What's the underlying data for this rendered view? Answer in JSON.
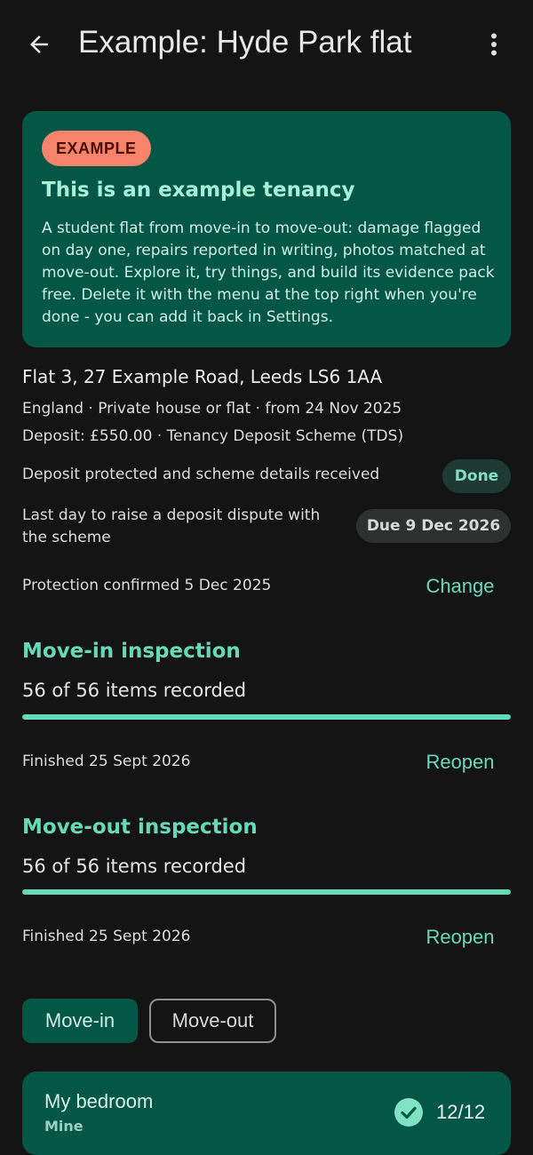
{
  "header": {
    "title": "Example: Hyde Park flat",
    "back_icon": "arrow-left-icon",
    "menu_icon": "more-vert-icon"
  },
  "example_card": {
    "badge": "EXAMPLE",
    "heading": "This is an example tenancy",
    "body": "A student flat from move-in to move-out: damage flagged on day one, repairs reported in writing, photos matched at move-out. Explore it, try things, and build its evidence pack free. Delete it with the menu at the top right when you're done - you can add it back in Settings."
  },
  "tenancy": {
    "address": "Flat 3, 27 Example Road, Leeds LS6 1AA",
    "meta_line1": "England · Private house or flat · from 24 Nov 2025",
    "meta_line2": "Deposit: £550.00 · Tenancy Deposit Scheme (TDS)"
  },
  "deposit": {
    "protected_text": "Deposit protected and scheme details received",
    "protected_status": "Done",
    "dispute_text": "Last day to raise a deposit dispute with the scheme",
    "dispute_status": "Due 9 Dec 2026",
    "confirmed_text": "Protection confirmed 5 Dec 2025",
    "change_label": "Change"
  },
  "move_in": {
    "title": "Move-in inspection",
    "items_text": "56 of 56 items recorded",
    "progress": 1.0,
    "finished_text": "Finished 25 Sept 2026",
    "action_label": "Reopen"
  },
  "move_out": {
    "title": "Move-out inspection",
    "items_text": "56 of 56 items recorded",
    "progress": 1.0,
    "finished_text": "Finished 25 Sept 2026",
    "action_label": "Reopen"
  },
  "tabs": {
    "selected": "Move-in",
    "move_in_label": "Move-in",
    "move_out_label": "Move-out"
  },
  "rooms": [
    {
      "name": "My bedroom",
      "owner": "Mine",
      "count": "12/12",
      "status_icon": "check-circle-icon"
    }
  ],
  "colors": {
    "accent": "#66d9b8",
    "card": "#045746",
    "badge": "#f7836b",
    "background": "#141414"
  }
}
